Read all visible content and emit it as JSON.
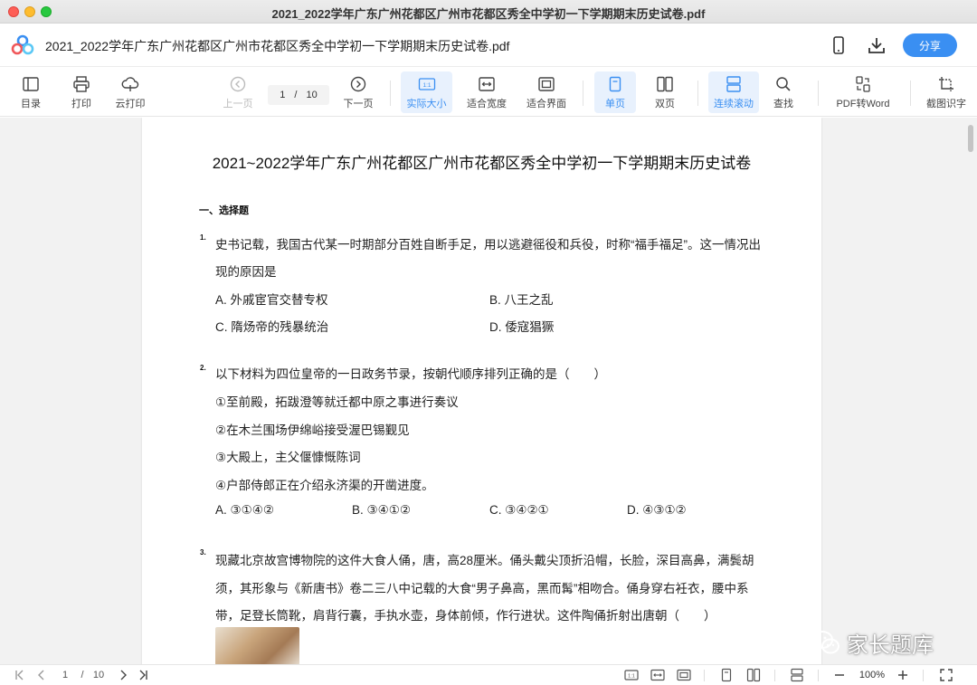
{
  "window": {
    "title": "2021_2022学年广东广州花都区广州市花都区秀全中学初一下学期期末历史试卷.pdf"
  },
  "header": {
    "doc_title": "2021_2022学年广东广州花都区广州市花都区秀全中学初一下学期期末历史试卷.pdf",
    "share_label": "分享",
    "icons": [
      "phone-icon",
      "download-icon"
    ],
    "accent_color": "#3a8ff2"
  },
  "toolbar": {
    "toc": "目录",
    "print": "打印",
    "cloud_print": "云打印",
    "prev_page": "上一页",
    "page_current": "1",
    "page_sep": "/",
    "page_total": "10",
    "next_page": "下一页",
    "actual_size": "实际大小",
    "fit_width": "适合宽度",
    "fit_screen": "适合界面",
    "single_page": "单页",
    "double_page": "双页",
    "continuous": "连续滚动",
    "find": "查找",
    "pdf_to_word": "PDF转Word",
    "screenshot_ocr": "截图识字",
    "actual_size_icon_text": "1:1"
  },
  "document": {
    "title": "2021~2022学年广东广州花都区广州市花都区秀全中学初一下学期期末历史试卷",
    "section": "一、选择题",
    "q1": {
      "num": "1.",
      "line1": "史书记载，我国古代某一时期部分百姓自断手足，用以逃避徭役和兵役，时称“福手福足”。这一情况出",
      "line2": "现的原因是",
      "a": "A. 外戚宦官交替专权",
      "b": "B. 八王之乱",
      "c": "C. 隋炀帝的残暴统治",
      "d": "D. 倭寇猖獗"
    },
    "q2": {
      "num": "2.",
      "line1": "以下材料为四位皇帝的一日政务节录，按朝代顺序排列正确的是（　　）",
      "i1": "①至前殿，拓跋澄等就迁都中原之事进行奏议",
      "i2": "②在木兰围场伊绵峪接受渥巴锡觐见",
      "i3": "③大殿上，主父偃慷慨陈词",
      "i4": "④户部侍郎正在介绍永济渠的开凿进度。",
      "a": "A. ③①④②",
      "b": "B. ③④①②",
      "c": "C. ③④②①",
      "d": "D. ④③①②"
    },
    "q3": {
      "num": "3.",
      "line1": "现藏北京故宫博物院的这件大食人俑，唐，高28厘米。俑头戴尖顶折沿帽，长脸，深目高鼻，满鬓胡",
      "line2": "须，其形象与《新唐书》卷二三八中记载的大食“男子鼻高，黑而髯”相吻合。俑身穿右衽衣，腰中系",
      "line3": "带，足登长筒靴，肩背行囊，手执水壶，身体前倾，作行进状。这件陶俑折射出唐朝（　　）"
    }
  },
  "bottombar": {
    "page_current": "1",
    "page_sep": "/",
    "page_total": "10",
    "zoom": "100%",
    "actual_size_icon_text": "1:1"
  },
  "watermark": {
    "text": "家长题库"
  }
}
